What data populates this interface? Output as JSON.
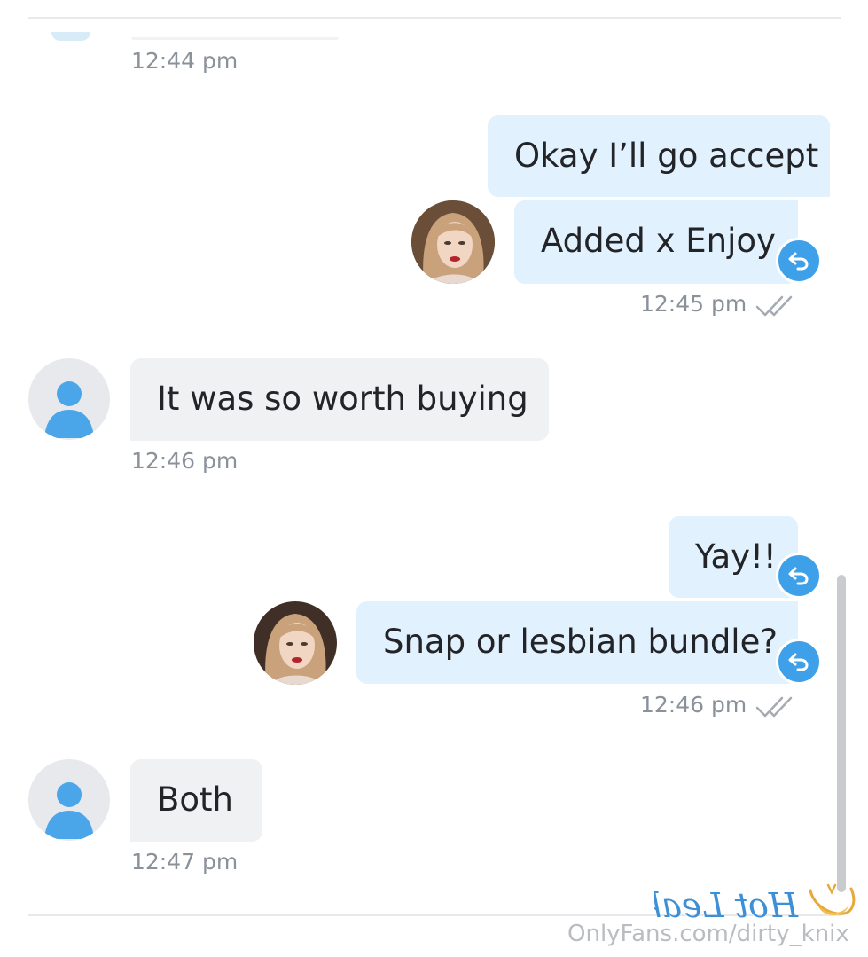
{
  "conversation": {
    "previous": {
      "time": "12:44 pm"
    },
    "group1": {
      "messages": [
        "Okay I’ll go accept",
        "Added x Enjoy"
      ],
      "time": "12:45 pm"
    },
    "msg_worth": {
      "text": "It was so worth buying",
      "time": "12:46 pm"
    },
    "group2": {
      "messages": [
        "Yay!!",
        "Snap or lesbian bundle?"
      ],
      "time": "12:46 pm"
    },
    "msg_both": {
      "text": "Both",
      "time": "12:47 pm"
    }
  },
  "watermark": {
    "url": "OnlyFans.com/dirty_knix",
    "logo_text": "Hot Leak"
  },
  "colors": {
    "sent_bubble": "#e1f1fd",
    "received_bubble": "#f0f1f3",
    "accent": "#3fa0ea",
    "timestamp": "#8a9199",
    "logo": "#3d8fd6"
  },
  "icons": {
    "undo": "undo-arrow-icon",
    "read": "double-check-icon",
    "user": "user-silhouette-icon"
  }
}
